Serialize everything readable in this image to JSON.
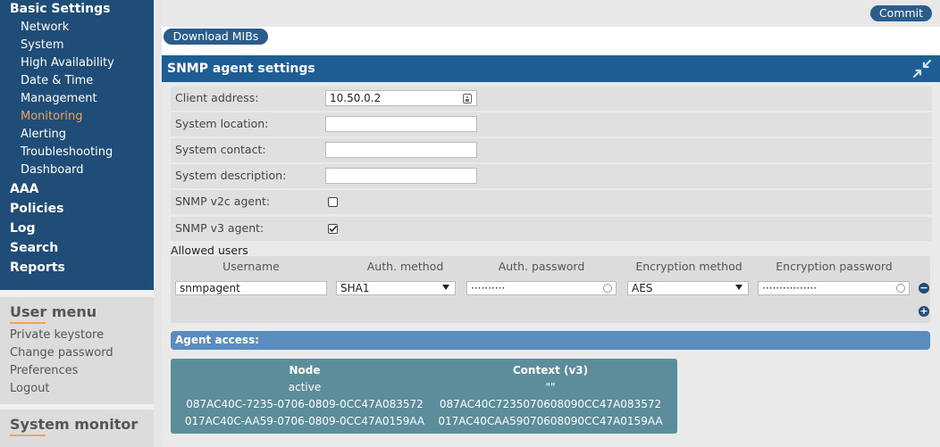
{
  "sidebar": {
    "basic_settings": "Basic Settings",
    "sub_items": [
      "Network",
      "System",
      "High Availability",
      "Date & Time",
      "Management",
      "Monitoring",
      "Alerting",
      "Troubleshooting",
      "Dashboard"
    ],
    "active_item": "Monitoring",
    "top_items": [
      "AAA",
      "Policies",
      "Log",
      "Search",
      "Reports"
    ],
    "user_menu": {
      "title": "User menu",
      "links": [
        "Private keystore",
        "Change password",
        "Preferences",
        "Logout"
      ]
    },
    "system_monitor": {
      "title": "System monitor"
    }
  },
  "toolbar": {
    "commit_label": "Commit",
    "download_label": "Download MIBs"
  },
  "panel": {
    "title": "SNMP agent settings",
    "collapse_icon": "shrink-arrows-icon"
  },
  "fields": {
    "client_address": {
      "label": "Client address:",
      "value": "10.50.0.2"
    },
    "system_location": {
      "label": "System location:",
      "value": ""
    },
    "system_contact": {
      "label": "System contact:",
      "value": ""
    },
    "system_description": {
      "label": "System description:",
      "value": ""
    },
    "snmp_v2c": {
      "label": "SNMP v2c agent:",
      "checked": false
    },
    "snmp_v3": {
      "label": "SNMP v3 agent:",
      "checked": true
    }
  },
  "users": {
    "label": "Allowed users",
    "columns": [
      "Username",
      "Auth. method",
      "Auth. password",
      "Encryption method",
      "Encryption password"
    ],
    "rows": [
      {
        "username": "snmpagent",
        "auth_method": "SHA1",
        "auth_password": "··········",
        "enc_method": "AES",
        "enc_password": "················"
      }
    ]
  },
  "agent_access": {
    "title": "Agent access:",
    "columns": [
      "Node",
      "Context (v3)"
    ],
    "rows": [
      [
        "active",
        "\"\""
      ],
      [
        "087AC40C-7235-0706-0809-0CC47A083572",
        "087AC40C7235070608090CC47A083572"
      ],
      [
        "017AC40C-AA59-0706-0809-0CC47A0159AA",
        "017AC40CAA59070608090CC47A0159AA"
      ]
    ]
  },
  "colors": {
    "nav_bg": "#1f4d78",
    "accent": "#f0a45a",
    "panel_header": "#1f5e94",
    "access_bar": "#5b8cc0",
    "table_bg": "#5b8e9a"
  }
}
